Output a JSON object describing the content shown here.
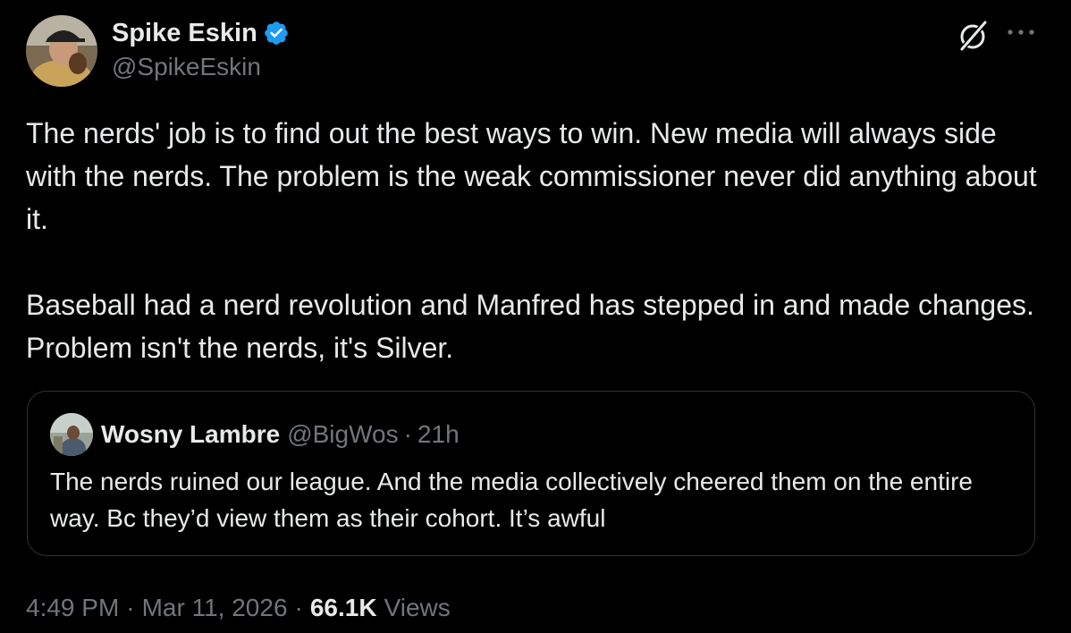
{
  "author": {
    "name": "Spike Eskin",
    "handle": "@SpikeEskin",
    "verified": true
  },
  "tweet": {
    "paragraphs": [
      "The nerds' job is to find out the best ways to win. New media will always side with the nerds. The problem is the weak commissioner never did anything about it.",
      "Baseball had a nerd revolution and Manfred has stepped in and made changes. Problem isn't the nerds, it's Silver."
    ]
  },
  "quote": {
    "name": "Wosny Lambre",
    "handle": "@BigWos",
    "separator": "·",
    "time": "21h",
    "text": "The nerds ruined our league. And the media collectively cheered them on the entire way. Bc they’d view them as their cohort. It’s awful"
  },
  "meta": {
    "time": "4:49 PM",
    "separator": "·",
    "date": "Mar 11, 2026",
    "views_count": "66.1K",
    "views_label": "Views"
  },
  "icons": {
    "verified": "verified-badge-icon",
    "grok": "grok-icon",
    "more": "more-options-icon"
  },
  "colors": {
    "background": "#000000",
    "text": "#e7e9ea",
    "secondary": "#71767b",
    "border": "#2f3336",
    "verified": "#1d9bf0"
  }
}
